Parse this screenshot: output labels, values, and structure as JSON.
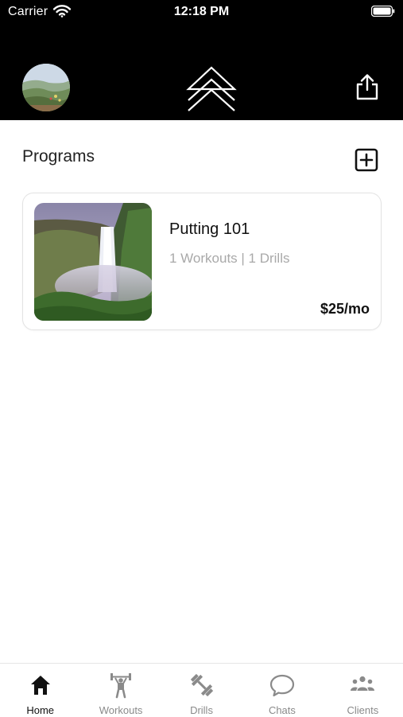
{
  "status_bar": {
    "carrier": "Carrier",
    "time": "12:18 PM"
  },
  "header": {
    "avatar_icon": "profile-avatar",
    "logo_icon": "double-chevron-up-logo",
    "share_icon": "share-icon"
  },
  "programs": {
    "title": "Programs",
    "add_icon": "plus-square-icon",
    "items": [
      {
        "title": "Putting 101",
        "meta": "1 Workouts | 1 Drills",
        "price": "$25/mo",
        "image": "waterfall"
      }
    ]
  },
  "tabbar": {
    "active": "Home",
    "tabs": [
      {
        "label": "Home",
        "icon": "home-icon"
      },
      {
        "label": "Workouts",
        "icon": "weightlifter-icon"
      },
      {
        "label": "Drills",
        "icon": "dumbbell-icon"
      },
      {
        "label": "Chats",
        "icon": "chat-bubble-icon"
      },
      {
        "label": "Clients",
        "icon": "clients-group-icon"
      }
    ]
  },
  "colors": {
    "header_bg": "#000000",
    "text_primary": "#111111",
    "text_muted": "#a9a9a9",
    "tab_inactive": "#8a8a8a",
    "card_border": "#e3e3e3"
  }
}
